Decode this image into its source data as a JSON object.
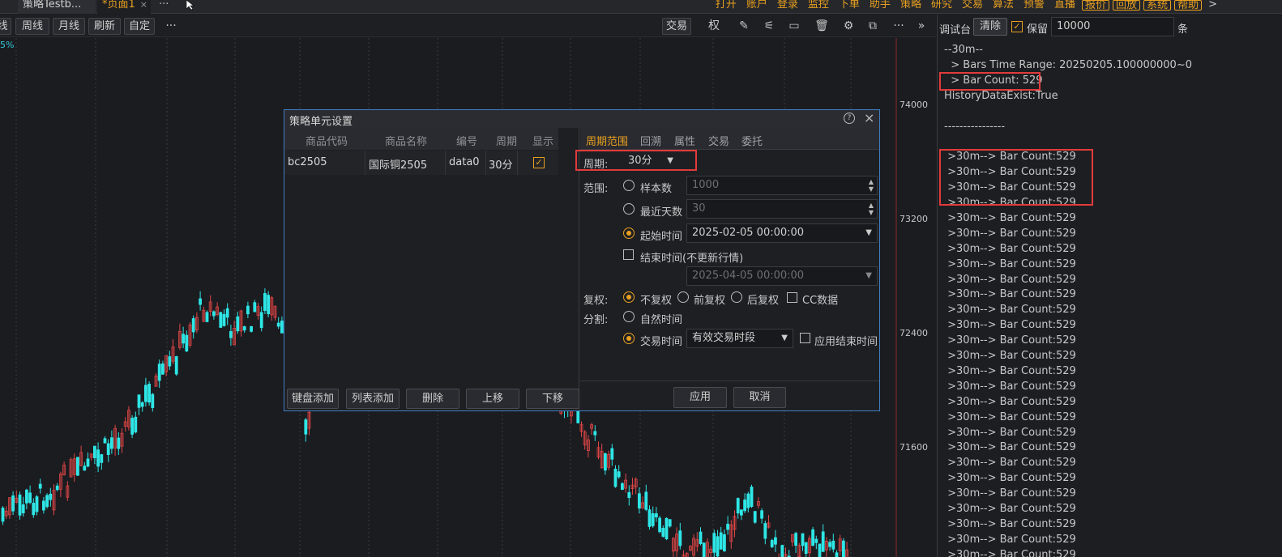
{
  "tabs": [
    {
      "label": "策略Testb...",
      "active": false
    },
    {
      "label": "*页面1",
      "active": true,
      "close": "×"
    }
  ],
  "tab_more": "···",
  "top_menu": [
    "打开",
    "账户",
    "登录",
    "监控",
    "下单",
    "助手",
    "策略",
    "研究",
    "交易",
    "算法",
    "预警",
    "直播",
    "报价",
    "回放",
    "系统",
    "帮助"
  ],
  "top_menu_boxed": [
    "报价",
    "回放",
    "系统",
    "帮助"
  ],
  "top_menu_arrow": ">",
  "chart_toolbar": {
    "buttons": [
      "线",
      "周线",
      "月线",
      "刷新",
      "自定"
    ],
    "more": "···",
    "trade_button": "交易",
    "right_text": "权",
    "more_right": "···",
    "expand": "»"
  },
  "chart": {
    "pct_label": "5%",
    "y_labels": [
      "74000",
      "73200",
      "72400",
      "71600"
    ],
    "up_color": "#e04646",
    "down_color": "#2ee6e6",
    "grid_color": "#3a3b40"
  },
  "debug": {
    "title": "调试台",
    "clear_label": "清除",
    "keep_label": "保留",
    "keep_checked": true,
    "count_value": "10000",
    "unit_label": "条",
    "lines": [
      "--30m--",
      "  > Bars Time Range: 20250205.100000000~0",
      "  > Bar Count: 529",
      "HistoryDataExist:True",
      "",
      "----------------",
      "",
      " >30m--> Bar Count:529",
      " >30m--> Bar Count:529",
      " >30m--> Bar Count:529",
      " >30m--> Bar Count:529",
      " >30m--> Bar Count:529",
      " >30m--> Bar Count:529",
      " >30m--> Bar Count:529",
      " >30m--> Bar Count:529",
      " >30m--> Bar Count:529",
      " >30m--> Bar Count:529",
      " >30m--> Bar Count:529",
      " >30m--> Bar Count:529",
      " >30m--> Bar Count:529",
      " >30m--> Bar Count:529",
      " >30m--> Bar Count:529",
      " >30m--> Bar Count:529",
      " >30m--> Bar Count:529",
      " >30m--> Bar Count:529",
      " >30m--> Bar Count:529",
      " >30m--> Bar Count:529",
      " >30m--> Bar Count:529",
      " >30m--> Bar Count:529",
      " >30m--> Bar Count:529",
      " >30m--> Bar Count:529",
      " >30m--> Bar Count:529",
      " >30m--> Bar Count:529",
      " >30m--> Bar Count:529"
    ]
  },
  "dialog": {
    "title": "策略单元设置",
    "help": "?",
    "close": "×",
    "grid_headers": [
      "商品代码",
      "商品名称",
      "编号",
      "周期",
      "显示"
    ],
    "rows": [
      {
        "code": "bc2505",
        "name": "国际铜2505",
        "id": "data0",
        "period": "30分",
        "show": true
      }
    ],
    "left_buttons": [
      "键盘添加",
      "列表添加",
      "删除",
      "上移",
      "下移"
    ],
    "tabs": [
      "周期范围",
      "回溯",
      "属性",
      "交易",
      "委托"
    ],
    "active_tab": "周期范围",
    "period_label": "周期:",
    "period_value": "30分",
    "range_label": "范围:",
    "sample_label": "样本数",
    "sample_value": "1000",
    "recent_days_label": "最近天数",
    "recent_days_value": "30",
    "start_time_label": "起始时间",
    "start_time_value": "2025-02-05 00:00:00",
    "end_time_label": "结束时间(不更新行情)",
    "end_time_value": "2025-04-05 00:00:00",
    "adjust_label": "复权:",
    "adjust_options": [
      "不复权",
      "前复权",
      "后复权"
    ],
    "cc_label": "CC数据",
    "split_label": "分割:",
    "natural_time_label": "自然时间",
    "trade_time_label": "交易时间",
    "trade_segment_value": "有效交易时段",
    "apply_end_label": "应用结束时间",
    "apply_button": "应用",
    "cancel_button": "取消"
  }
}
